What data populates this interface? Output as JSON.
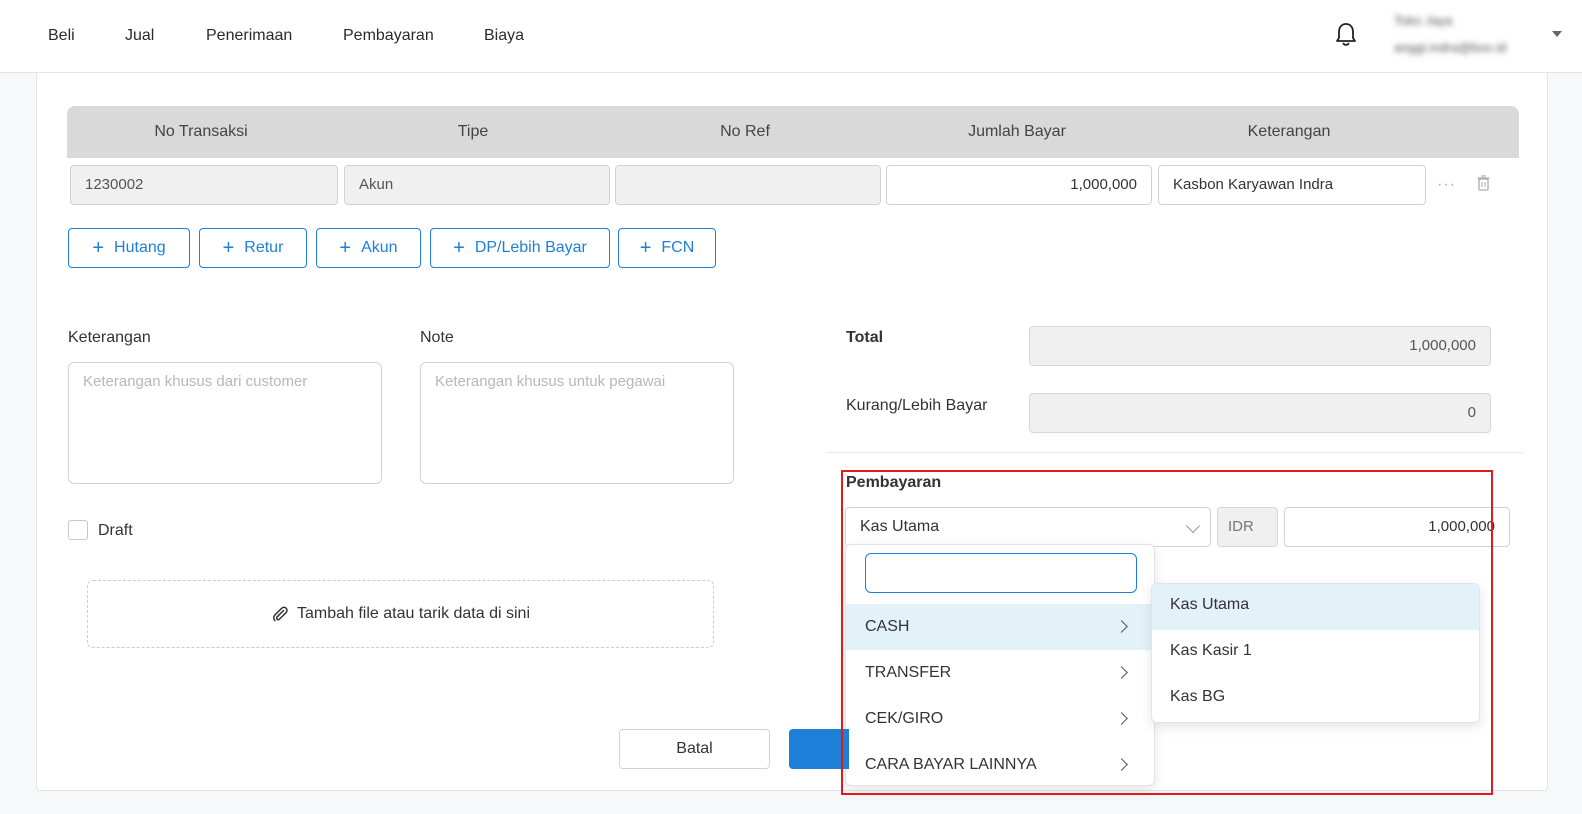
{
  "nav": {
    "items": [
      "Beli",
      "Jual",
      "Penerimaan",
      "Pembayaran",
      "Biaya"
    ],
    "user_name": "Toko Jaya",
    "user_email": "anggi.indra@box.id"
  },
  "table": {
    "headers": [
      "No Transaksi",
      "Tipe",
      "No Ref",
      "Jumlah Bayar",
      "Keterangan"
    ],
    "row": {
      "no_transaksi": "1230002",
      "tipe": "Akun",
      "no_ref": "",
      "jumlah_bayar": "1,000,000",
      "keterangan": "Kasbon Karyawan Indra"
    },
    "row_more": "···"
  },
  "add_buttons": [
    "Hutang",
    "Retur",
    "Akun",
    "DP/Lebih Bayar",
    "FCN"
  ],
  "form": {
    "keterangan_label": "Keterangan",
    "keterangan_placeholder": "Keterangan khusus dari customer",
    "note_label": "Note",
    "note_placeholder": "Keterangan khusus untuk pegawai",
    "draft_label": "Draft",
    "dropzone_text": "Tambah file atau tarik data di sini"
  },
  "summary": {
    "total_label": "Total",
    "total_value": "1,000,000",
    "kurang_label": "Kurang/Lebih Bayar",
    "kurang_value": "0"
  },
  "payment": {
    "label": "Pembayaran",
    "selected": "Kas Utama",
    "currency": "IDR",
    "amount": "1,000,000",
    "categories": [
      "CASH",
      "TRANSFER",
      "CEK/GIRO",
      "CARA BAYAR LAINNYA"
    ],
    "cash_accounts": [
      "Kas Utama",
      "Kas Kasir 1",
      "Kas BG"
    ]
  },
  "actions": {
    "cancel": "Batal"
  },
  "colors": {
    "accent": "#1e7fd8",
    "highlight": "#e11b1b",
    "active_row": "#e3f1f8"
  }
}
